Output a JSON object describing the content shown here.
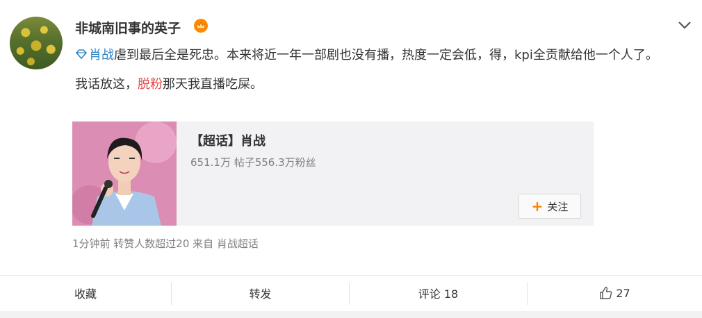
{
  "post": {
    "username": "非城南旧事的英子",
    "badge_icon": "crown-icon",
    "menu_icon": "chevron-down-icon",
    "topic": "肖战",
    "line1_rest": "虐到最后全是死忠。本来将近一年一部剧也没有播，热度一定会低，得，kpi全贡献给他一个人了。",
    "line2_a": "我话放这，",
    "line2_red": "脱粉",
    "line2_b": "那天我直播吃屎。",
    "meta": "1分钟前 转赞人数超过20  来自 肖战超话"
  },
  "card": {
    "title": "【超话】肖战",
    "subtitle": "651.1万 帖子556.3万粉丝",
    "follow_label": "关注"
  },
  "actions": {
    "favorite": "收藏",
    "repost": "转发",
    "comment": "评论 18",
    "like_count": "27"
  },
  "colors": {
    "link": "#2f86c6",
    "highlight": "#e24a4a",
    "accent": "#ff8200"
  }
}
